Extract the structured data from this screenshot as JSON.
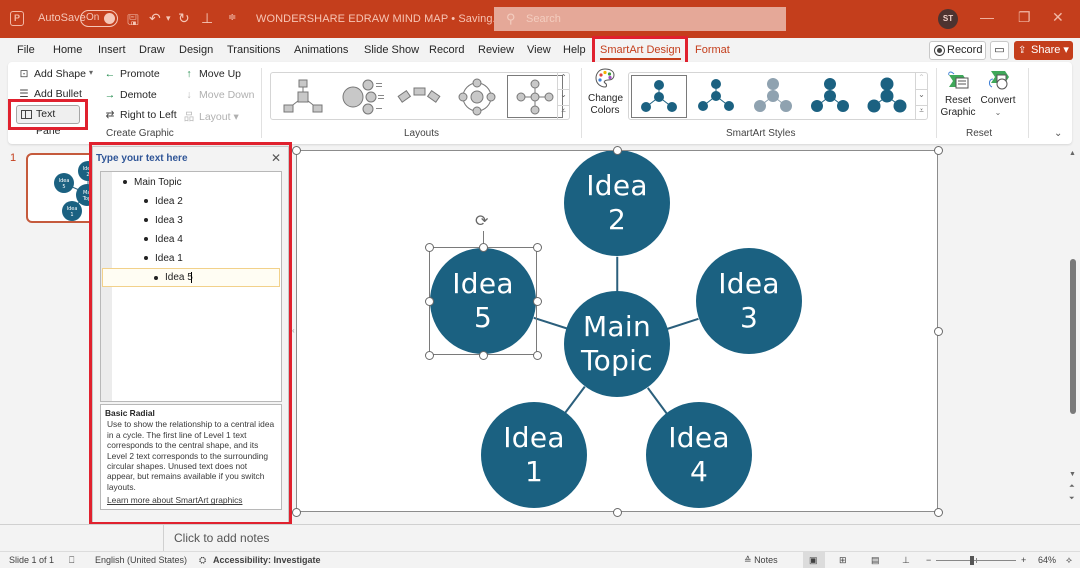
{
  "titlebar": {
    "app_icon": "powerpoint-icon",
    "autosave_label": "AutoSave",
    "autosave_state": "On",
    "document_title": "WONDERSHARE EDRAW MIND MAP • Saving... ∨",
    "search_placeholder": "Search",
    "user_initials": "ST",
    "icons": [
      "save-icon",
      "undo-icon",
      "redo-icon",
      "present-icon",
      "customize-quick-access-icon"
    ],
    "window_controls": [
      "minimize-icon",
      "restore-icon",
      "close-icon"
    ]
  },
  "menu": {
    "items": [
      "File",
      "Home",
      "Insert",
      "Draw",
      "Design",
      "Transitions",
      "Animations",
      "Slide Show",
      "Record",
      "Review",
      "View",
      "Help",
      "SmartArt Design",
      "Format"
    ],
    "active": "SmartArt Design",
    "record_label": "Record",
    "share_label": "Share"
  },
  "ribbon": {
    "create_graphic": {
      "label": "Create Graphic",
      "add_shape": "Add Shape",
      "add_bullet": "Add Bullet",
      "text_pane": "Text Pane",
      "promote": "Promote",
      "demote": "Demote",
      "right_to_left": "Right to Left",
      "move_up": "Move Up",
      "move_down": "Move Down",
      "layout": "Layout"
    },
    "layouts": {
      "label": "Layouts",
      "items": [
        "Hierarchy Radial",
        "Radial List",
        "Basic Bending",
        "Radial Cycle",
        "Basic Radial"
      ],
      "selected": "Basic Radial"
    },
    "smartart_styles": {
      "label": "SmartArt Styles",
      "change_colors": "Change Colors",
      "items": [
        "Simple Fill",
        "Flat",
        "Subtle Effect",
        "Moderate Effect",
        "Intense Effect"
      ],
      "selected": "Simple Fill"
    },
    "reset": {
      "label": "Reset",
      "reset_graphic": "Reset Graphic",
      "convert": "Convert"
    }
  },
  "slides_panel": {
    "slide_number": "1",
    "thumb_nodes": [
      "Idea 2",
      "Idea 5",
      "Main Topic",
      "Idea 1"
    ]
  },
  "text_pane": {
    "title": "Type your text here",
    "items": [
      {
        "level": 1,
        "text": "Main Topic"
      },
      {
        "level": 2,
        "text": "Idea 2"
      },
      {
        "level": 2,
        "text": "Idea 3"
      },
      {
        "level": 2,
        "text": "Idea 4"
      },
      {
        "level": 2,
        "text": "Idea 1"
      },
      {
        "level": 2,
        "text": "Idea 5",
        "active": true
      }
    ],
    "description_title": "Basic Radial",
    "description": "Use to show the relationship to a central idea in a cycle. The first line of Level 1 text corresponds to the central shape, and its Level 2 text corresponds to the surrounding circular shapes. Unused text does not appear, but remains available if you switch layouts.",
    "learn_more": "Learn more about SmartArt graphics"
  },
  "diagram": {
    "node_color": "#1b6181",
    "center": {
      "line1": "Main",
      "line2": "Topic"
    },
    "nodes": [
      {
        "id": "idea2",
        "line1": "Idea",
        "line2": "2"
      },
      {
        "id": "idea3",
        "line1": "Idea",
        "line2": "3"
      },
      {
        "id": "idea4",
        "line1": "Idea",
        "line2": "4"
      },
      {
        "id": "idea1",
        "line1": "Idea",
        "line2": "1"
      },
      {
        "id": "idea5",
        "line1": "Idea",
        "line2": "5",
        "selected": true
      }
    ]
  },
  "notes": {
    "placeholder": "Click to add notes"
  },
  "status": {
    "slide_info": "Slide 1 of 1",
    "language": "English (United States)",
    "accessibility": "Accessibility: Investigate",
    "notes_label": "Notes",
    "zoom_level": "64%",
    "zoom_fraction": 0.45
  },
  "colors": {
    "accent": "#c43e1c",
    "highlight_box": "#e0212e"
  }
}
